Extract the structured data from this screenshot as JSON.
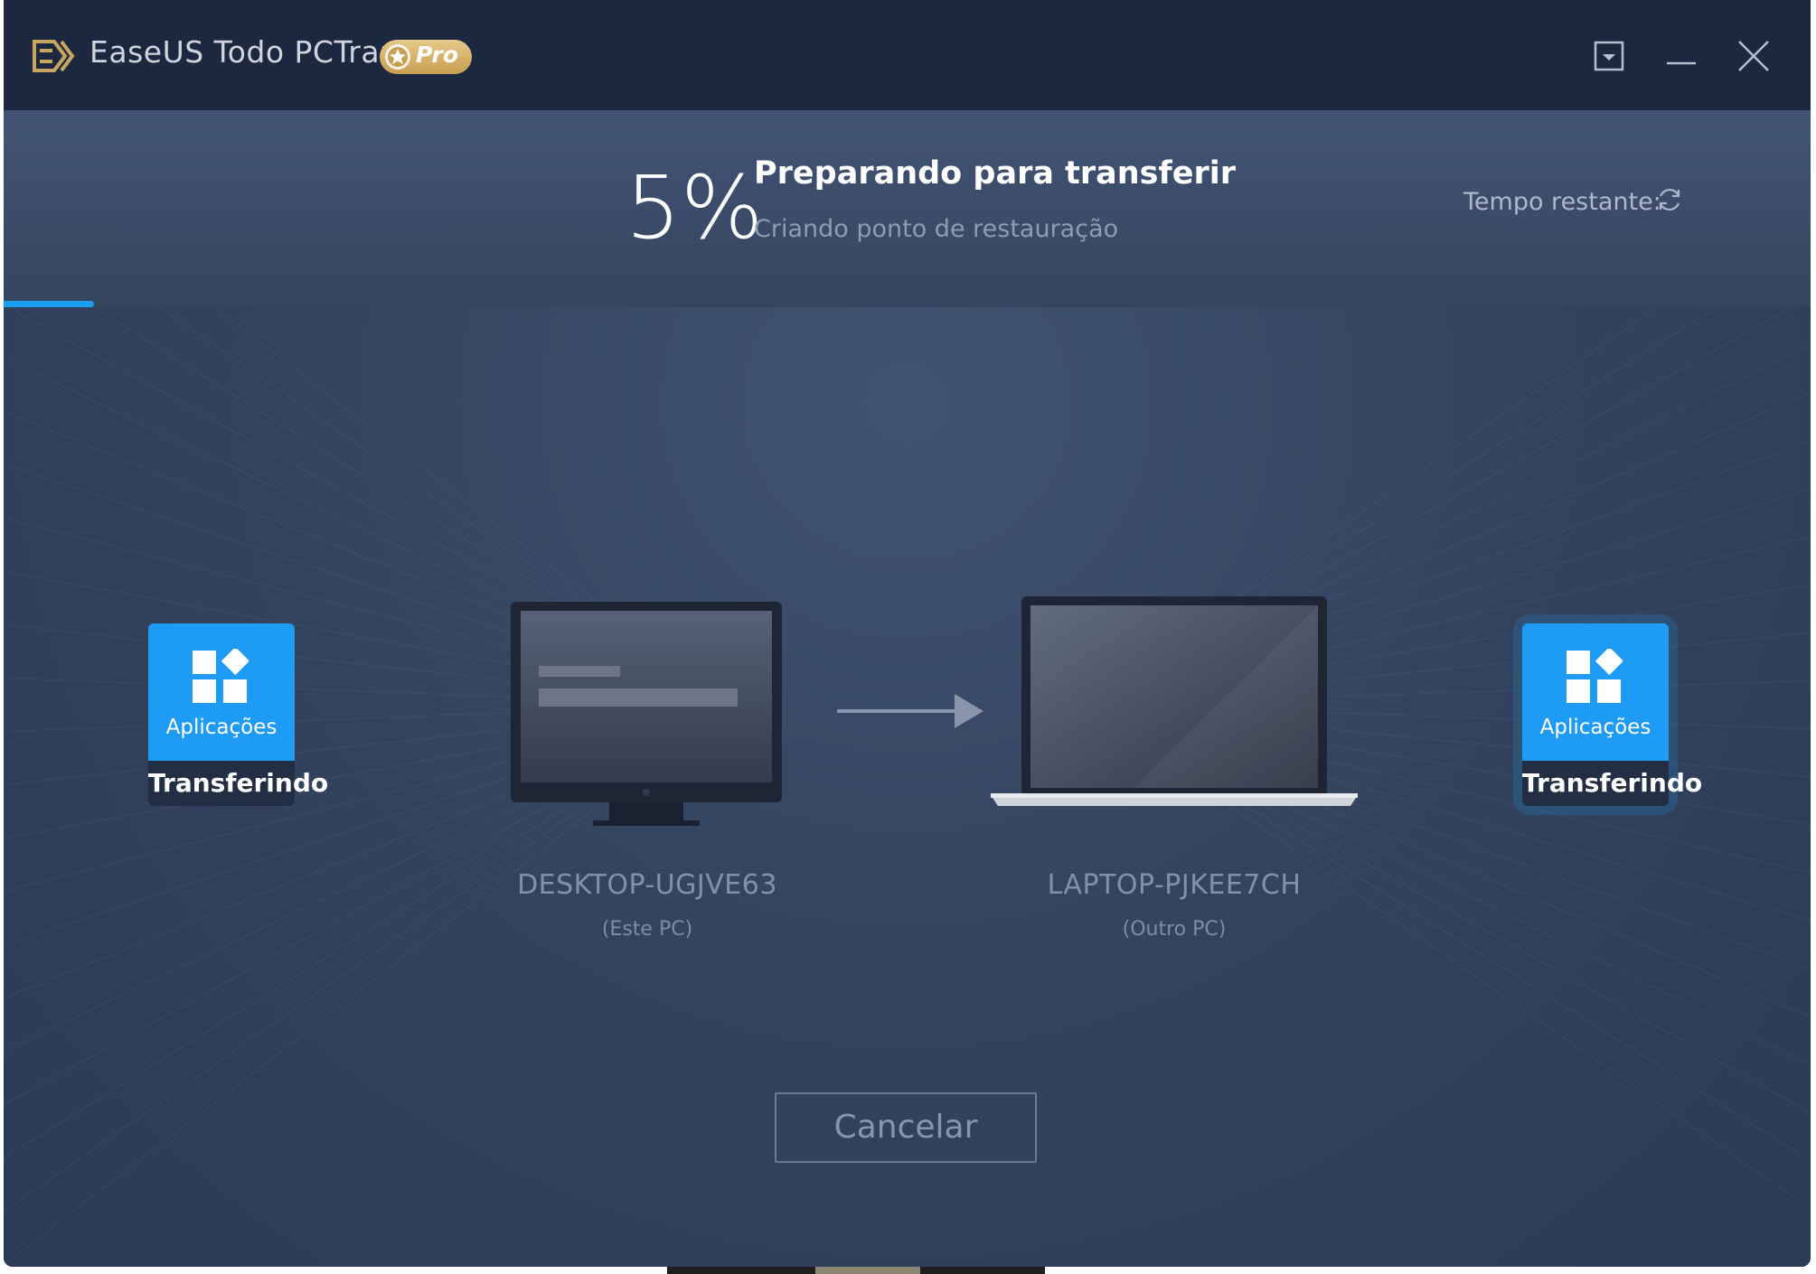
{
  "app": {
    "title": "EaseUS Todo PCTrans",
    "badge": "Pro",
    "logo_icon": "easeus-logo-icon",
    "window_controls": [
      "dropdown-menu-icon",
      "minimize-icon",
      "close-icon"
    ]
  },
  "header": {
    "percent": "5%",
    "progress": 0.05,
    "title": "Preparando para transferir",
    "subtitle": "Criando ponto de restauração",
    "time_label": "Tempo restante:",
    "time_icon": "refresh-icon",
    "accent": "#1c9df0"
  },
  "source": {
    "tile_label": "Aplicações",
    "tile_status": "Transferindo",
    "tile_icon": "apps-grid-icon",
    "device_name": "DESKTOP-UGJVE63",
    "device_sub": "(Este PC)",
    "device_icon": "desktop-monitor-icon"
  },
  "target": {
    "tile_label": "Aplicações",
    "tile_status": "Transferindo",
    "tile_icon": "apps-grid-icon",
    "device_name": "LAPTOP-PJKEE7CH",
    "device_sub": "(Outro PC)",
    "device_icon": "laptop-icon"
  },
  "transfer_arrow_icon": "arrow-right-icon",
  "cancel_label": "Cancelar",
  "colors": {
    "titlebar": "#1c2840",
    "background": "#2c3c58",
    "tile_blue": "#1e9bf4",
    "tile_dark": "#222e44"
  }
}
